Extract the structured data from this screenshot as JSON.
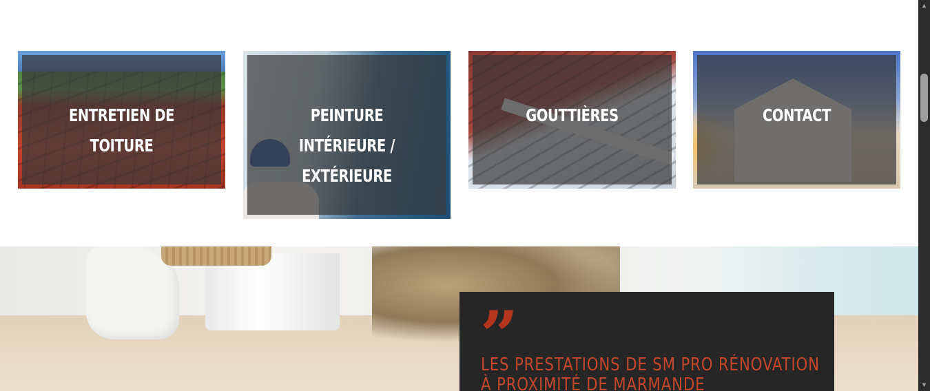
{
  "services": [
    {
      "id": "card-1",
      "label": "ENTRETIEN DE TOITURE"
    },
    {
      "id": "card-2",
      "label_line1": "PEINTURE INTÉRIEURE /",
      "label_line2": "EXTÉRIEURE"
    },
    {
      "id": "card-3",
      "label": "GOUTTIÈRES"
    },
    {
      "id": "card-4",
      "label": "CONTACT"
    }
  ],
  "hero": {
    "quote_icon": "”",
    "title_line1": "LES PRESTATIONS DE SM PRO RÉNOVATION",
    "title_line2": "À PROXIMITÉ DE MARMANDE"
  },
  "scrollbar": {
    "up_arrow": "▲",
    "down_arrow": "▼"
  },
  "colors": {
    "accent": "#c6462b",
    "quote_box": "#262626",
    "card_overlay": "#373737"
  }
}
